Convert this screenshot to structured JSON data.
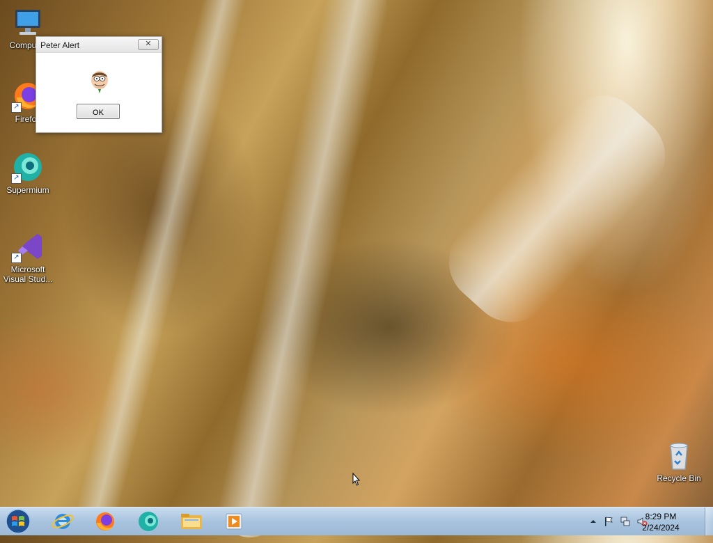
{
  "desktop": {
    "icons": [
      {
        "label": "Computer",
        "icon": "computer-icon"
      },
      {
        "label": "Firefox",
        "icon": "firefox-icon"
      },
      {
        "label": "Supermium",
        "icon": "supermium-icon"
      },
      {
        "label": "Microsoft Visual Stud...",
        "icon": "visual-studio-icon"
      },
      {
        "label": "Recycle Bin",
        "icon": "recycle-bin-icon"
      }
    ]
  },
  "dialog": {
    "title": "Peter Alert",
    "close_label": "✕",
    "image": "peter-griffin-face-icon",
    "ok_label": "OK"
  },
  "taskbar": {
    "start": "windows-start-orb",
    "pinned": [
      "internet-explorer-icon",
      "firefox-icon",
      "supermium-icon",
      "file-explorer-icon",
      "media-player-icon"
    ],
    "tray": {
      "icons": [
        "show-hidden-icons-arrow",
        "action-center-flag-icon",
        "network-icon",
        "volume-muted-icon"
      ],
      "time": "8:29 PM",
      "date": "2/24/2024"
    }
  },
  "colors": {
    "taskbar": "#a8c3de",
    "dialog_bg": "#f0f0f0"
  }
}
